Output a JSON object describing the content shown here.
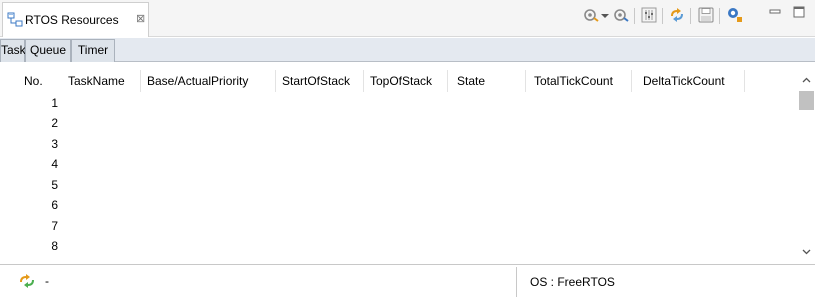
{
  "view": {
    "title": "RTOS Resources",
    "close_glyph": "⊠",
    "icons": [
      "rtos-resources-view-icon",
      "close-icon"
    ]
  },
  "toolbar": {
    "icons": [
      "refresh-icon",
      "dropdown-arrow-icon",
      "auto-refresh-icon",
      "table-settings-icon",
      "sync-icon",
      "save-icon",
      "search-icon",
      "minimize-icon",
      "maximize-icon"
    ]
  },
  "subtabs": [
    {
      "label": "Task"
    },
    {
      "label": "Queue"
    },
    {
      "label": "Timer"
    }
  ],
  "table": {
    "columns": [
      "No.",
      "TaskName",
      "Base/ActualPriority",
      "StartOfStack",
      "TopOfStack",
      "State",
      "TotalTickCount",
      "DeltaTickCount"
    ],
    "rows": [
      "1",
      "2",
      "3",
      "4",
      "5",
      "6",
      "7",
      "8"
    ]
  },
  "status": {
    "left_text": "-",
    "os_text": "OS : FreeRTOS",
    "icon": "sync-status-icon"
  },
  "colors": {
    "subtab_bar": "#e4e9f0",
    "accent_orange": "#e59a1a",
    "accent_blue": "#3b78c4",
    "scroll_thumb": "#c1c1c1"
  }
}
